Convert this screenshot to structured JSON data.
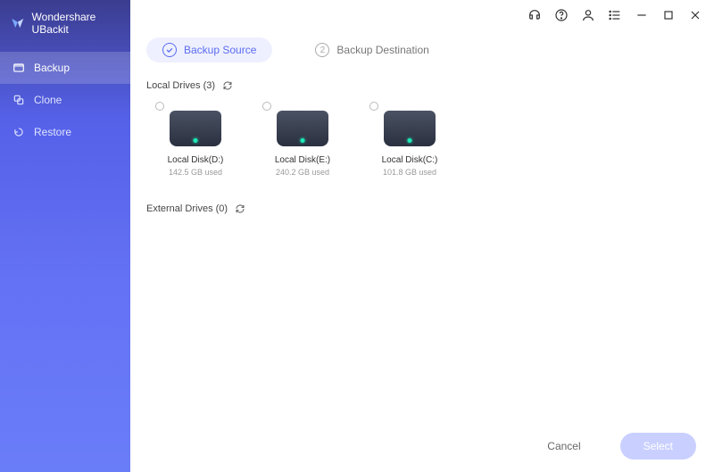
{
  "app": {
    "title": "Wondershare UBackit"
  },
  "sidebar": {
    "items": [
      {
        "label": "Backup"
      },
      {
        "label": "Clone"
      },
      {
        "label": "Restore"
      }
    ]
  },
  "steps": {
    "source": {
      "label": "Backup Source"
    },
    "dest": {
      "number": "2",
      "label": "Backup Destination"
    }
  },
  "local": {
    "header": "Local Drives (3)",
    "drives": [
      {
        "name": "Local Disk(D:)",
        "size": "142.5 GB used"
      },
      {
        "name": "Local Disk(E:)",
        "size": "240.2 GB used"
      },
      {
        "name": "Local Disk(C:)",
        "size": "101.8 GB used"
      }
    ]
  },
  "external": {
    "header": "External Drives (0)"
  },
  "footer": {
    "cancel": "Cancel",
    "select": "Select"
  }
}
